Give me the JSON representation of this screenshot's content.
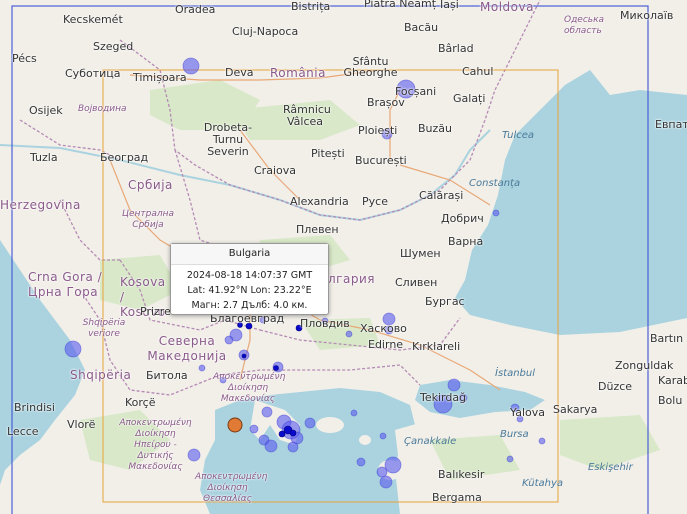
{
  "popup": {
    "title": "Bulgaria",
    "datetime": "2024-08-18 14:07:37 GMT",
    "coords": "Lat: 41.92°N Lon: 23.22°E",
    "magnitude": "Магн: 2.7 Дълб: 4.0 км."
  },
  "labels": {
    "oradea": "Oradea",
    "bistrita": "Bistrița",
    "piatra": "Piatra Neamț",
    "iasi": "Iași",
    "moldova": "Moldova",
    "odesa": "Одеська область",
    "mykolaiv": "Миколаїв",
    "kecskemet": "Kecskemét",
    "cluj": "Cluj-Napoca",
    "bacau": "Bacău",
    "szeged": "Szeged",
    "sfantu": "Sfântu Gheorghe",
    "barlad": "Bârlad",
    "pecs": "Pécs",
    "subotica": "Суботица",
    "timisoara": "Timișoara",
    "deva": "Deva",
    "romania": "România",
    "cahul": "Cahul",
    "osijek": "Osijek",
    "vojvodina": "Војводина",
    "brasov": "Brașov",
    "focsani": "Focșani",
    "galati": "Galați",
    "ramnicu": "Râmnicu Vâlcea",
    "ploiesti": "Ploiești",
    "buzau": "Buzău",
    "tulcea": "Tulcea",
    "tuzla": "Tuzla",
    "beograd": "Београд",
    "drobeta": "Drobeta-Turnu Severin",
    "pitesti": "Pitești",
    "bucuresti": "București",
    "evpatoria": "Евпатор",
    "srbija": "Србија",
    "craiova": "Craiova",
    "constanta": "Constanța",
    "calarasi": "Călărași",
    "herzegovina": "Herzegovina",
    "alexandria": "Alexandria",
    "ruse": "Русе",
    "dobrich": "Добрич",
    "central_serbia": "Централна Србија",
    "pleven": "Плевен",
    "varna": "Варна",
    "shumen": "Шумен",
    "crna_gora": "Crna Gora / Црна Гора",
    "kosova": "Kosova / Kosovo",
    "bulgaria_partial": "лгария",
    "sliven": "Сливен",
    "burgas": "Бургас",
    "prizren": "Prizren",
    "shqiperia_veriore": "Shqipëria veriore",
    "plovdiv": "Пловдив",
    "haskovo": "Хасково",
    "blagoevgrad": "Благоевград",
    "severna": "Северна Македонија",
    "edirne": "Edirne",
    "kirklareli": "Kırklareli",
    "bartin": "Bartın",
    "shqiperia": "Shqipëria",
    "bitola": "Битола",
    "zonguldak": "Zonguldak",
    "karabuk": "Karabü",
    "istanbul": "İstanbul",
    "apokentromeni_mak": "Αποκεντρωμένη Διοίκηση Μακεδονίας",
    "duzce": "Düzce",
    "tekirdag": "Tekirdağ",
    "bolu": "Bolu",
    "korce": "Korçë",
    "brindisi": "Brindisi",
    "yalova": "Yalova",
    "sakarya": "Sakarya",
    "vlore": "Vlorë",
    "lecce": "Lecce",
    "apokentromeni_ip": "Αποκεντρωμένη Διοίκηση Ηπείρου - Δυτικής Μακεδονίας",
    "bursa": "Bursa",
    "canakkale": "Çanakkale",
    "eskisehir": "Eskişehir",
    "balikesir": "Balıkesir",
    "apokentromeni_th": "Αποκεντρωμένη Διοίκηση Θεσσαλίας",
    "bergama": "Bergama",
    "kutahya": "Kütahya"
  },
  "colors": {
    "land": "#f2efe9",
    "sea": "#aad3df",
    "border": "#b58ab5",
    "bbox_orange": "#e8a33a",
    "bbox_blue": "#4b5fd6",
    "quake_fill": "#5a5af0",
    "quake_dark": "#0a0acc",
    "selected": "#e07a35"
  }
}
